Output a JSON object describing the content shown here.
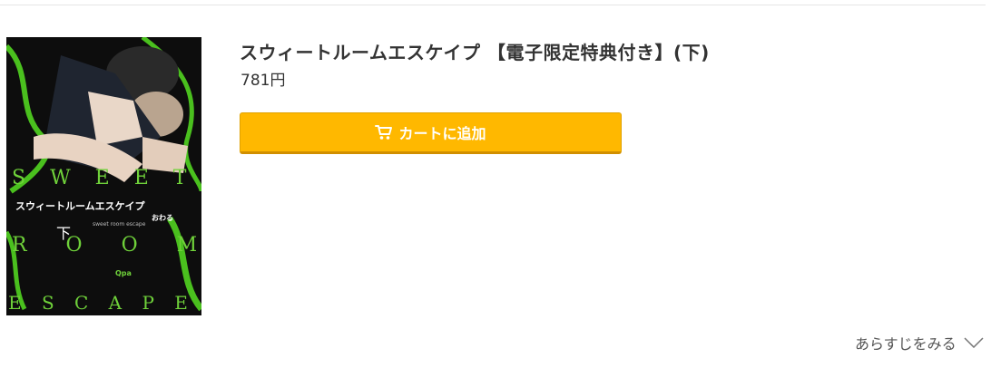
{
  "product": {
    "title": "スウィートルームエスケイプ 【電子限定特典付き】(下)",
    "price": "781円",
    "cart_button_label": "カートに追加",
    "synopsis_link_label": "あらすじをみる"
  },
  "cover": {
    "line1": "S W E E T",
    "title_jp": "スウィートルームエスケイプ",
    "volume": "下",
    "subtitle_en": "sweet room escape",
    "author": "おわる",
    "line2": "R O O M",
    "line3": "E S C A P E",
    "publisher_mark": "Qpa",
    "accent_color": "#6fd13a"
  },
  "colors": {
    "cart_button": "#ffb800",
    "text": "#333333"
  },
  "icons": {
    "cart": "cart-icon",
    "chevron": "chevron-down-icon"
  }
}
